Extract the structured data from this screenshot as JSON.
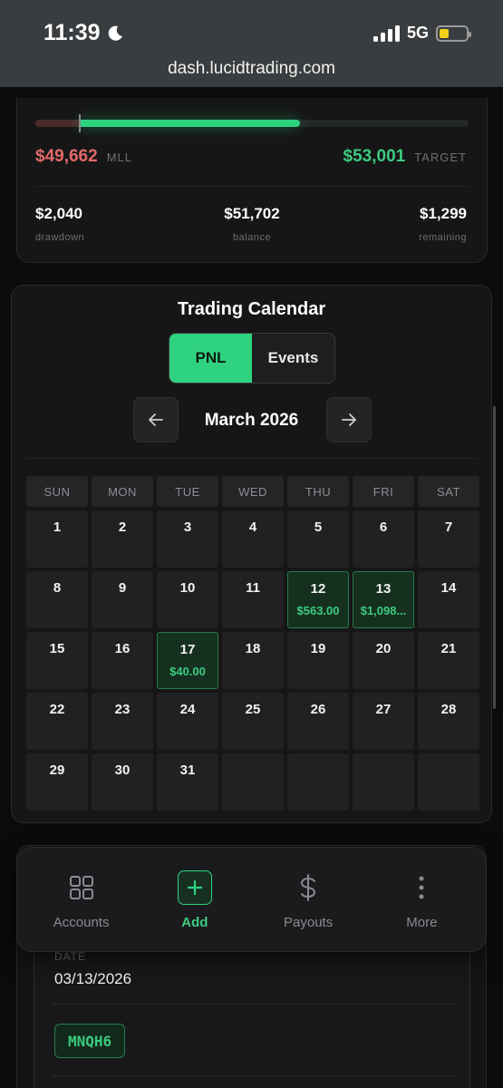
{
  "status_bar": {
    "time": "11:39",
    "network": "5G",
    "battery_level": 0.25
  },
  "browser": {
    "url": "dash.lucidtrading.com"
  },
  "balance_card": {
    "mll_value": "$49,662",
    "mll_label": "MLL",
    "target_value": "$53,001",
    "target_label": "TARGET",
    "progress_fraction": 0.61,
    "stats": [
      {
        "value": "$2,040",
        "label": "drawdown"
      },
      {
        "value": "$51,702",
        "label": "balance"
      },
      {
        "value": "$1,299",
        "label": "remaining"
      }
    ]
  },
  "calendar": {
    "title": "Trading Calendar",
    "tabs": [
      "PNL",
      "Events"
    ],
    "active_tab": "PNL",
    "month": "March 2026",
    "weekdays": [
      "SUN",
      "MON",
      "TUE",
      "WED",
      "THU",
      "FRI",
      "SAT"
    ],
    "days": [
      {
        "num": "1"
      },
      {
        "num": "2"
      },
      {
        "num": "3"
      },
      {
        "num": "4"
      },
      {
        "num": "5"
      },
      {
        "num": "6"
      },
      {
        "num": "7"
      },
      {
        "num": "8"
      },
      {
        "num": "9"
      },
      {
        "num": "10"
      },
      {
        "num": "11"
      },
      {
        "num": "12",
        "pnl": "$563.00"
      },
      {
        "num": "13",
        "pnl": "$1,098..."
      },
      {
        "num": "14"
      },
      {
        "num": "15"
      },
      {
        "num": "16"
      },
      {
        "num": "17",
        "pnl": "$40.00"
      },
      {
        "num": "18"
      },
      {
        "num": "19"
      },
      {
        "num": "20"
      },
      {
        "num": "21"
      },
      {
        "num": "22"
      },
      {
        "num": "23"
      },
      {
        "num": "24"
      },
      {
        "num": "25"
      },
      {
        "num": "26"
      },
      {
        "num": "27"
      },
      {
        "num": "28"
      },
      {
        "num": "29"
      },
      {
        "num": "30"
      },
      {
        "num": "31"
      },
      {
        "num": ""
      },
      {
        "num": ""
      },
      {
        "num": ""
      },
      {
        "num": ""
      }
    ]
  },
  "bottom_nav": {
    "items": [
      {
        "label": "Accounts",
        "icon": "grid-icon"
      },
      {
        "label": "Add",
        "icon": "plus-icon"
      },
      {
        "label": "Payouts",
        "icon": "dollar-icon"
      },
      {
        "label": "More",
        "icon": "more-vertical-icon"
      }
    ],
    "active": "Add"
  },
  "detail": {
    "date_label": "DATE",
    "date_value": "03/13/2026",
    "symbol": "MNQH6"
  },
  "colors": {
    "accent_green": "#2fd37f",
    "loss_red": "#e46a6a",
    "background": "#0b0b0c"
  }
}
